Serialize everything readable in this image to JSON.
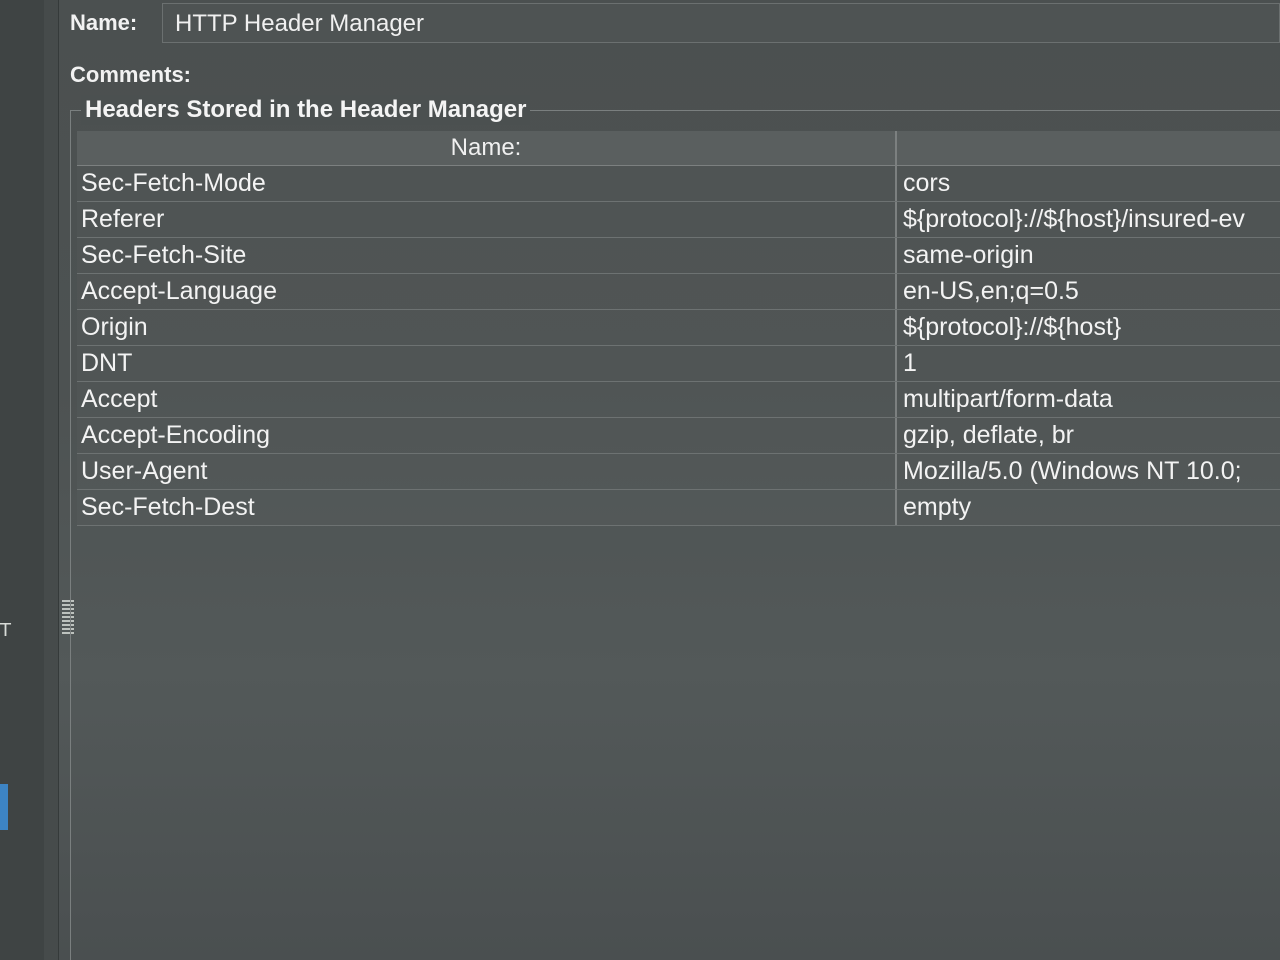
{
  "form": {
    "name_label": "Name:",
    "name_value": "HTTP Header Manager",
    "comments_label": "Comments:",
    "comments_value": ""
  },
  "headers_panel": {
    "title": "Headers Stored in the Header Manager",
    "columns": [
      "Name:",
      ""
    ],
    "rows": [
      {
        "name": "Sec-Fetch-Mode",
        "value": "cors"
      },
      {
        "name": "Referer",
        "value": "${protocol}://${host}/insured-ev"
      },
      {
        "name": "Sec-Fetch-Site",
        "value": "same-origin"
      },
      {
        "name": "Accept-Language",
        "value": "en-US,en;q=0.5"
      },
      {
        "name": "Origin",
        "value": "${protocol}://${host}"
      },
      {
        "name": "DNT",
        "value": "1"
      },
      {
        "name": "Accept",
        "value": "multipart/form-data"
      },
      {
        "name": "Accept-Encoding",
        "value": "gzip, deflate, br"
      },
      {
        "name": "User-Agent",
        "value": "Mozilla/5.0 (Windows NT 10.0;"
      },
      {
        "name": "Sec-Fetch-Dest",
        "value": "empty"
      }
    ]
  },
  "left_strip": {
    "partial_char": "T"
  }
}
